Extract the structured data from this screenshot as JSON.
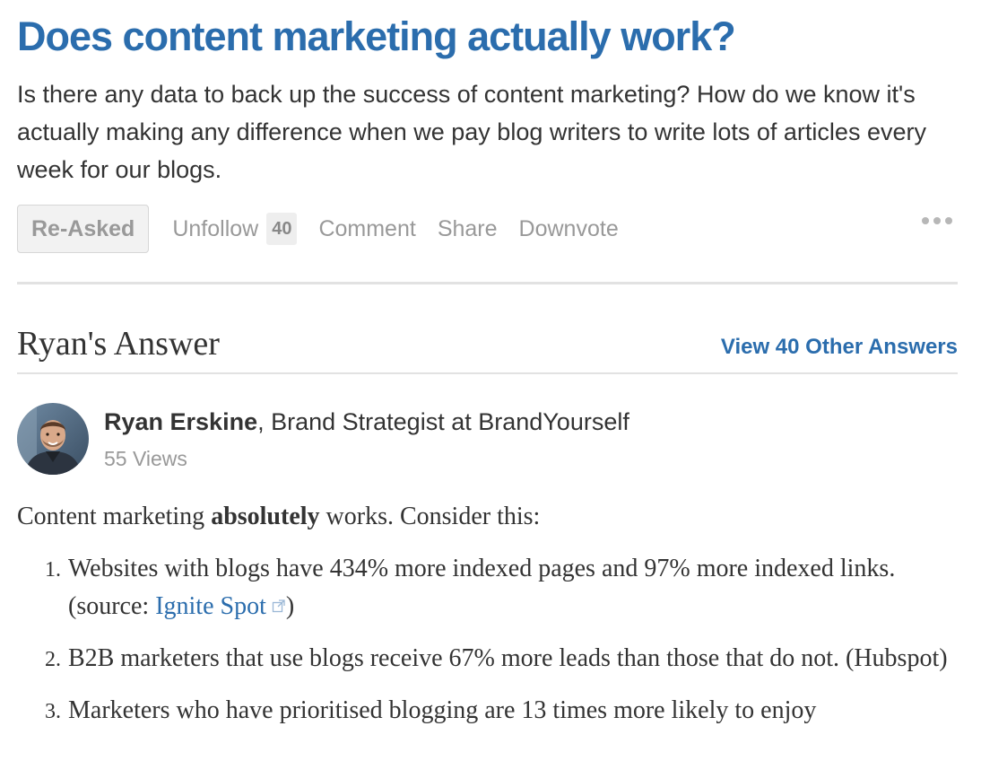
{
  "question": {
    "title": "Does content marketing actually work?",
    "details": "Is there any data to back up the success of content marketing? How do we know it's actually making any difference when we pay blog writers to write lots of articles every week for our blogs."
  },
  "actions": {
    "reasked": "Re-Asked",
    "unfollow": "Unfollow",
    "follow_count": "40",
    "comment": "Comment",
    "share": "Share",
    "downvote": "Downvote",
    "more_icon": "ellipsis-icon"
  },
  "answer_header": {
    "title": "Ryan's Answer",
    "view_others": "View 40 Other Answers"
  },
  "author": {
    "name": "Ryan Erskine",
    "credential": ", Brand Strategist at BrandYourself",
    "views": "55 Views"
  },
  "answer": {
    "intro_before": "Content marketing ",
    "intro_bold": "absolutely",
    "intro_after": " works. Consider this:",
    "items": [
      {
        "text_before": "Websites with blogs have 434% more indexed pages and 97% more indexed links. (source: ",
        "link_text": "Ignite Spot",
        "text_after": ")"
      },
      {
        "text": "B2B marketers that use blogs receive 67% more leads than those that do not. (Hubspot)"
      },
      {
        "text": "Marketers who have prioritised blogging are 13 times more likely to enjoy"
      }
    ]
  },
  "colors": {
    "link_blue": "#2b6dad",
    "muted_gray": "#999999",
    "text": "#333333"
  }
}
